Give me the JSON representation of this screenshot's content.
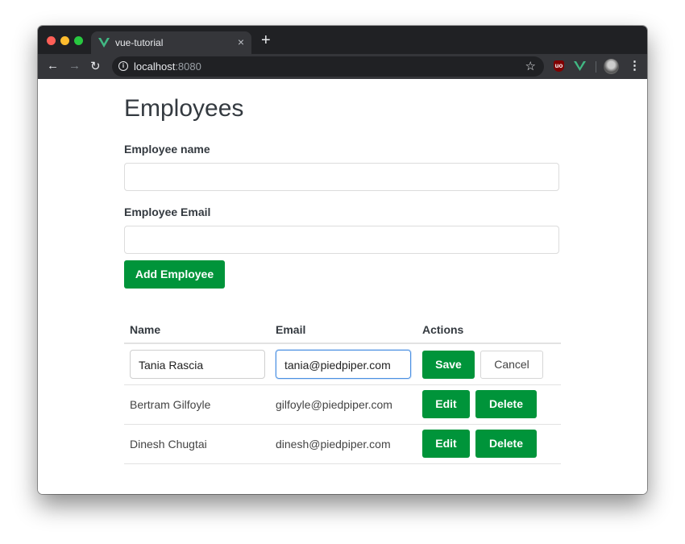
{
  "browser": {
    "tab_title": "vue-tutorial",
    "url_host": "localhost",
    "url_port": ":8080",
    "icons": [
      "back-arrow-icon",
      "forward-arrow-icon",
      "reload-icon",
      "info-icon",
      "star-icon",
      "ublock-icon",
      "vue-devtools-icon",
      "avatar",
      "menu-icon"
    ]
  },
  "page": {
    "title": "Employees",
    "name_label": "Employee name",
    "name_value": "",
    "email_label": "Employee Email",
    "email_value": "",
    "add_button": "Add Employee"
  },
  "table": {
    "headers": [
      "Name",
      "Email",
      "Actions"
    ],
    "editing_row": {
      "name": "Tania Rascia",
      "email": "tania@piedpiper.com",
      "save": "Save",
      "cancel": "Cancel"
    },
    "rows": [
      {
        "name": "Bertram Gilfoyle",
        "email": "gilfoyle@piedpiper.com",
        "edit": "Edit",
        "delete": "Delete"
      },
      {
        "name": "Dinesh Chugtai",
        "email": "dinesh@piedpiper.com",
        "edit": "Edit",
        "delete": "Delete"
      }
    ]
  },
  "colors": {
    "primary": "#00943a",
    "focus": "#4a90e2"
  }
}
